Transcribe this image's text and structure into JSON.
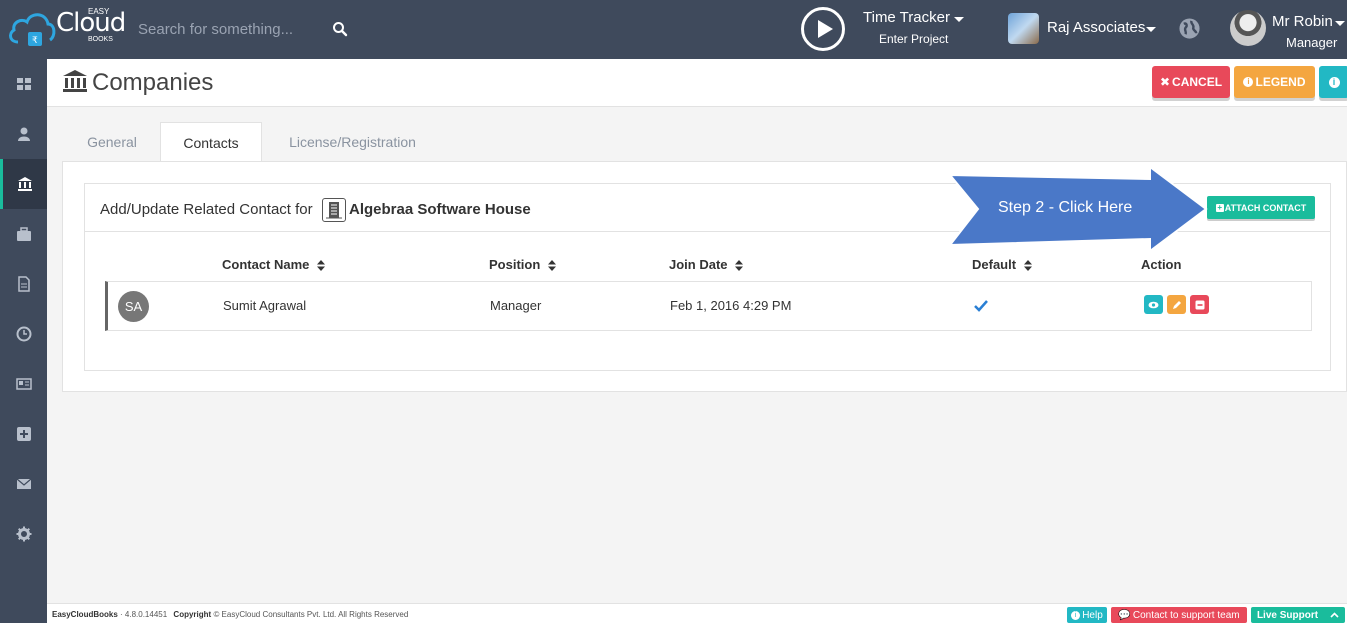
{
  "topbar": {
    "logo_main": "Cloud",
    "logo_easy": "EASY",
    "logo_books": "BOOKS",
    "search_placeholder": "Search for something...",
    "time_tracker_title": "Time Tracker",
    "time_tracker_sub": "Enter Project",
    "company_name": "Raj Associates",
    "user_name": "Mr Robin",
    "user_role": "Manager"
  },
  "sidebar": {
    "items": [
      "dashboard-icon",
      "user-icon",
      "bank-icon",
      "briefcase-icon",
      "document-icon",
      "clock-icon",
      "newspaper-icon",
      "plus-square-icon",
      "envelope-icon",
      "gear-icon"
    ],
    "active_index": 2
  },
  "header": {
    "title": "Companies",
    "cancel_label": "CANCEL",
    "legend_label": "LEGEND"
  },
  "tabs": [
    {
      "label": "General"
    },
    {
      "label": "Contacts"
    },
    {
      "label": "License/Registration"
    }
  ],
  "card": {
    "title": "Add/Update Related Contact for",
    "company": "Algebraa Software House",
    "attach_label": "ATTACH CONTACT"
  },
  "table": {
    "headers": [
      "Contact Name",
      "Position",
      "Join Date",
      "Default",
      "Action"
    ],
    "rows": [
      {
        "initials": "SA",
        "name": "Sumit Agrawal",
        "position": "Manager",
        "join_date": "Feb 1, 2016 4:29 PM",
        "default": true
      }
    ]
  },
  "callout": {
    "text": "Step 2 - Click Here"
  },
  "footer": {
    "app": "EasyCloudBooks",
    "version": "· 4.8.0.14451",
    "copyright_label": "Copyright",
    "copyright_text": "© EasyCloud Consultants Pvt. Ltd. All Rights Reserved",
    "help_label": "Help",
    "support_label": "Contact to support team",
    "live_label": "Live Support"
  },
  "colors": {
    "topbar": "#3f4a5c",
    "danger": "#e8495a",
    "warning": "#f4a640",
    "info": "#22b8c4",
    "success": "#1abc9c",
    "callout": "#4a78c8"
  }
}
